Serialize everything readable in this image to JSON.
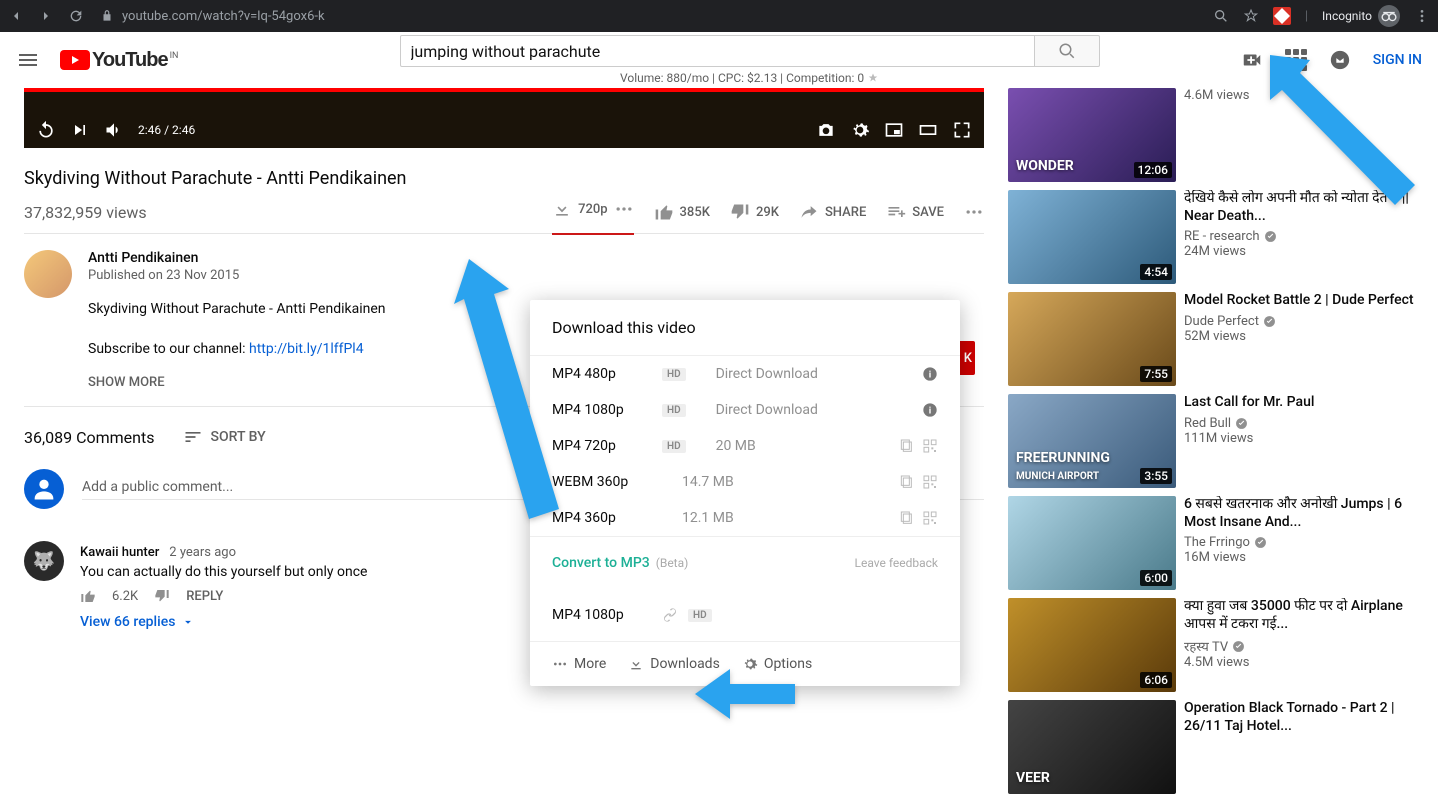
{
  "browser": {
    "url": "youtube.com/watch?v=lq-54gox6-k",
    "incognito": "Incognito"
  },
  "header": {
    "logo_text": "YouTube",
    "logo_sup": "IN",
    "search_value": "jumping without parachute",
    "seo_line": "Volume: 880/mo | CPC: $2.13 | Competition: 0",
    "sign_in": "SIGN IN"
  },
  "player": {
    "time": "2:46 / 2:46"
  },
  "video": {
    "title": "Skydiving Without Parachute - Antti Pendikainen",
    "views": "37,832,959 views",
    "download_label": "720p",
    "likes": "385K",
    "dislikes": "29K",
    "share": "SHARE",
    "save": "SAVE"
  },
  "channel": {
    "name": "Antti Pendikainen",
    "published": "Published on 23 Nov 2015",
    "desc_line1": "Skydiving Without Parachute - Antti Pendikainen",
    "desc_line2_prefix": "Subscribe to our channel: ",
    "desc_link": "http://bit.ly/1lffPl4",
    "show_more": "SHOW MORE",
    "subscribe_edge": "K"
  },
  "comments": {
    "count": "36,089 Comments",
    "sort_by": "SORT BY",
    "placeholder": "Add a public comment...",
    "item": {
      "author": "Kawaii hunter",
      "time": "2 years ago",
      "text": "You can actually do this yourself but only once",
      "likes": "6.2K",
      "reply": "REPLY",
      "replies": "View 66 replies"
    }
  },
  "download_popup": {
    "title": "Download this video",
    "rows": [
      {
        "fmt": "MP4 480p",
        "hd": true,
        "meta": "Direct Download",
        "info": true
      },
      {
        "fmt": "MP4 1080p",
        "hd": true,
        "meta": "Direct Download",
        "info": true
      },
      {
        "fmt": "MP4 720p",
        "hd": true,
        "meta": "20 MB",
        "copy": true
      },
      {
        "fmt": "WEBM 360p",
        "hd": false,
        "meta": "14.7 MB",
        "copy": true
      },
      {
        "fmt": "MP4 360p",
        "hd": false,
        "meta": "12.1 MB",
        "copy": true
      }
    ],
    "convert": "Convert to MP3",
    "beta": "(Beta)",
    "feedback": "Leave feedback",
    "link_row": {
      "fmt": "MP4 1080p",
      "hd": true
    },
    "footer": {
      "more": "More",
      "downloads": "Downloads",
      "options": "Options"
    }
  },
  "sidebar": [
    {
      "duration": "12:06",
      "title_visible": "",
      "channel": "",
      "views": "4.6M views",
      "thumb_text": "WONDER"
    },
    {
      "duration": "4:54",
      "title": "देखिये कैसे लोग अपनी मौत को न्योता देते है || Near Death...",
      "channel": "RE - research",
      "views": "24M views"
    },
    {
      "duration": "7:55",
      "title": "Model Rocket Battle 2 | Dude Perfect",
      "channel": "Dude Perfect",
      "views": "52M views"
    },
    {
      "duration": "3:55",
      "title": "Last Call for Mr. Paul",
      "channel": "Red Bull",
      "views": "111M views",
      "thumb_text": "FREERUNNING",
      "thumb_sub": "MUNICH AIRPORT"
    },
    {
      "duration": "6:00",
      "title": "6 सबसे खतरनाक और अनोखी Jumps | 6 Most Insane And...",
      "channel": "The Frringo",
      "views": "16M views"
    },
    {
      "duration": "6:06",
      "title": "क्या हुवा जब 35000 फीट पर दो Airplane आपस में टकरा गई...",
      "channel": "रहस्य TV",
      "views": "4.5M views"
    },
    {
      "duration": "",
      "title": "Operation Black Tornado - Part 2 | 26/11 Taj Hotel...",
      "channel": "",
      "views": "",
      "thumb_text": "VEER"
    }
  ]
}
